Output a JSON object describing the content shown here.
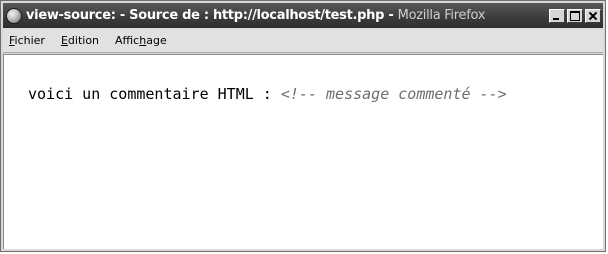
{
  "window": {
    "title_prefix": "view-source: - Source de : http://localhost/test.php - ",
    "title_app": "Mozilla Firefox",
    "icon": "firefox-icon"
  },
  "window_buttons": {
    "minimize_icon": "minimize-icon",
    "maximize_icon": "maximize-icon",
    "close_icon": "close-icon"
  },
  "menu": {
    "items": [
      {
        "first": "F",
        "rest": "ichier",
        "ul_pos": "first"
      },
      {
        "first": "E",
        "rest": "dition",
        "ul_pos": "first"
      },
      {
        "pre": "Affic",
        "ul": "h",
        "post": "age"
      }
    ]
  },
  "source": {
    "text": "voici un commentaire HTML : ",
    "comment": "<!-- message commenté -->"
  },
  "colors": {
    "comment": "#6e6e6e",
    "titlebar": "#3d3d3d"
  }
}
